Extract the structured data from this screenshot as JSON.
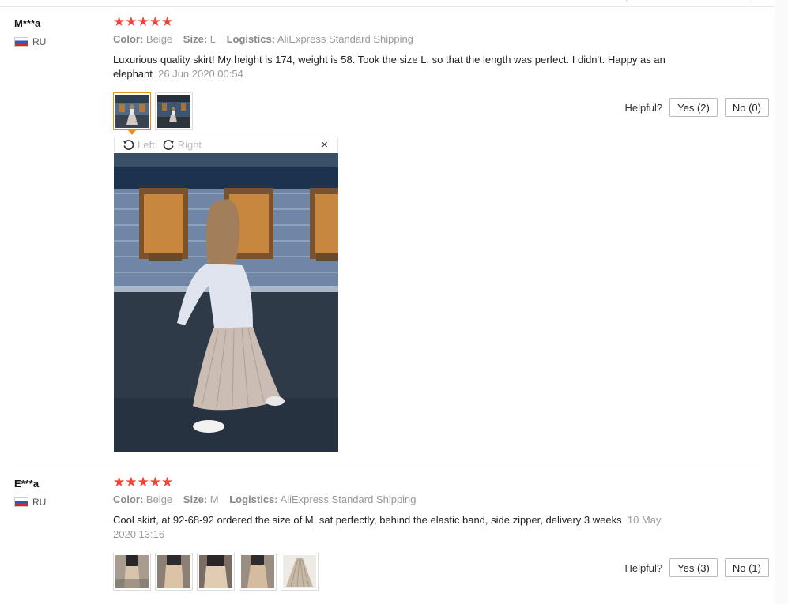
{
  "reviews": [
    {
      "user": "M***a",
      "country": "RU",
      "stars": "★★★★★",
      "color_label": "Color:",
      "color_value": "Beige",
      "size_label": "Size:",
      "size_value": "L",
      "logistics_label": "Logistics:",
      "logistics_value": "AliExpress Standard Shipping",
      "text": "Luxurious quality skirt! My height is 174, weight is 58. Took the size L, so that the length was perfect. I didn't. Happy as an elephant",
      "date": "26 Jun 2020 00:54",
      "helpful_label": "Helpful?",
      "yes_label": "Yes (2)",
      "no_label": "No (0)"
    },
    {
      "user": "E***a",
      "country": "RU",
      "stars": "★★★★★",
      "color_label": "Color:",
      "color_value": "Beige",
      "size_label": "Size:",
      "size_value": "M",
      "logistics_label": "Logistics:",
      "logistics_value": "AliExpress Standard Shipping",
      "text": "Cool skirt, at 92-68-92 ordered the size of M, sat perfectly, behind the elastic band, side zipper, delivery 3 weeks",
      "date": "10 May 2020 13:16",
      "helpful_label": "Helpful?",
      "yes_label": "Yes (3)",
      "no_label": "No (1)"
    }
  ],
  "viewer": {
    "rotate_left_label": "Left",
    "rotate_right_label": "Right",
    "close_icon": "×"
  },
  "colors": {
    "star": "#f44336",
    "active_thumb_border": "#e8921a"
  }
}
